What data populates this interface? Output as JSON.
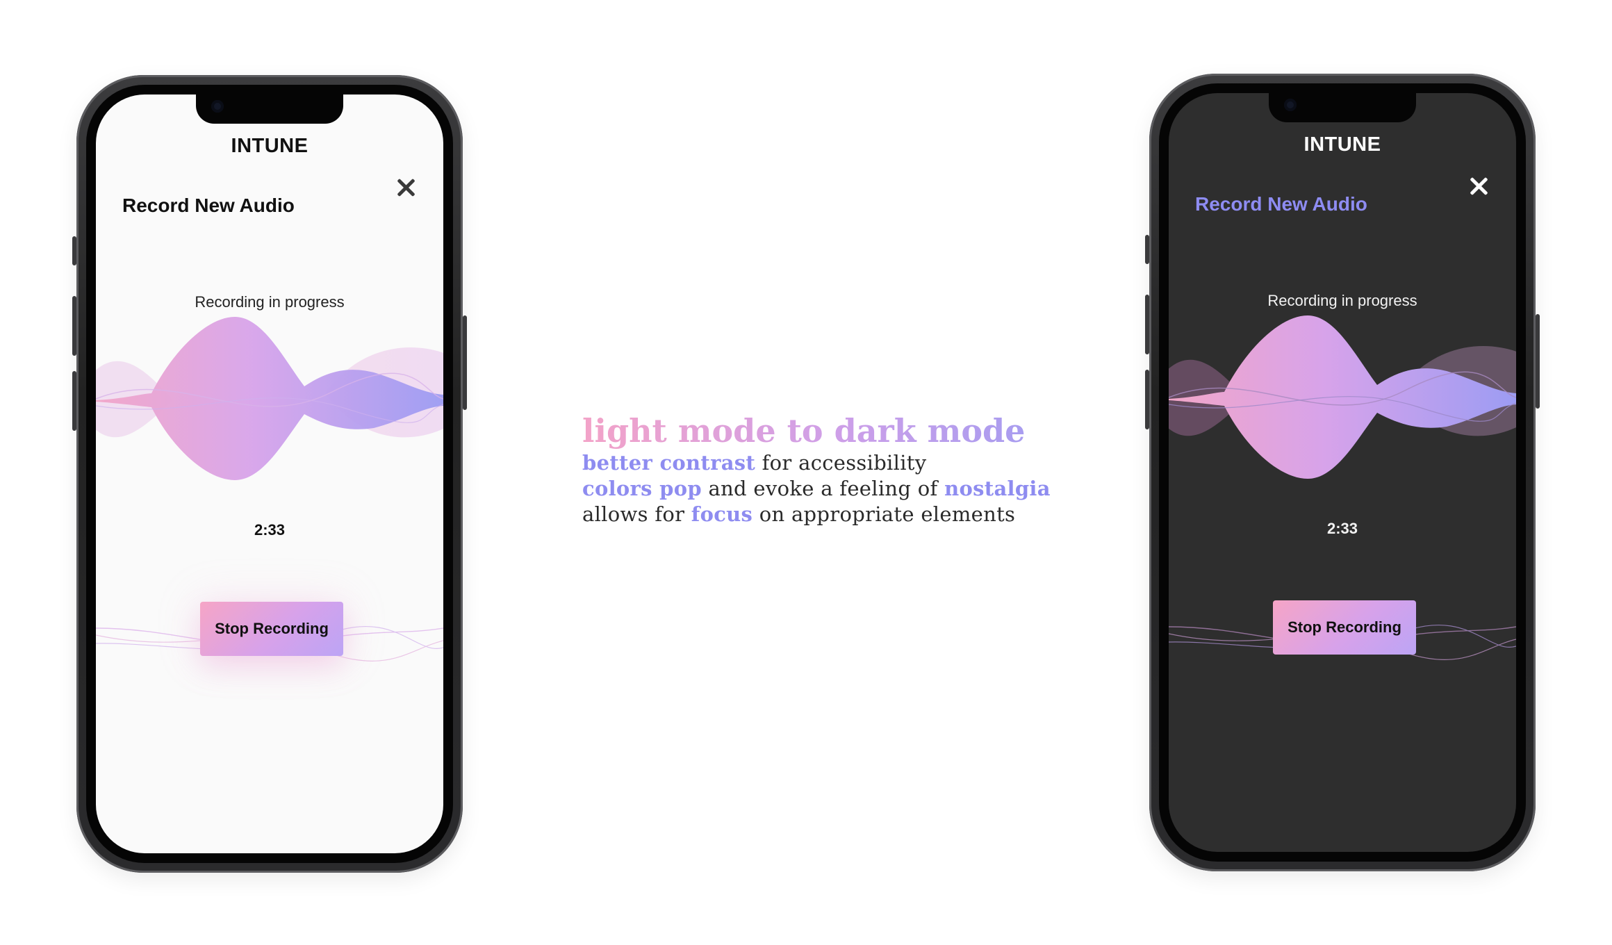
{
  "colors": {
    "accent_pink": "#f6a5c6",
    "accent_purple": "#bca4f5",
    "accent_blue": "#8e8cf2",
    "dark_bg": "#2e2e2e",
    "light_bg": "#fafafa"
  },
  "phones": {
    "light": {
      "app_title": "INTUNE",
      "section_title": "Record New Audio",
      "close_icon": "close-icon",
      "status": "Recording in progress",
      "timer": "2:33",
      "stop_label": "Stop Recording"
    },
    "dark": {
      "app_title": "INTUNE",
      "section_title": "Record New Audio",
      "close_icon": "close-icon",
      "status": "Recording in progress",
      "timer": "2:33",
      "stop_label": "Stop Recording"
    }
  },
  "caption": {
    "headline": "light mode to dark mode",
    "lines": [
      {
        "highlight": "better contrast",
        "rest": " for accessibility"
      },
      {
        "highlight": "colors pop",
        "middle": " and evoke a feeling of ",
        "highlight2": "nostalgia"
      },
      {
        "lead": "allows for ",
        "highlight": "focus",
        "rest": " on appropriate elements"
      }
    ]
  }
}
